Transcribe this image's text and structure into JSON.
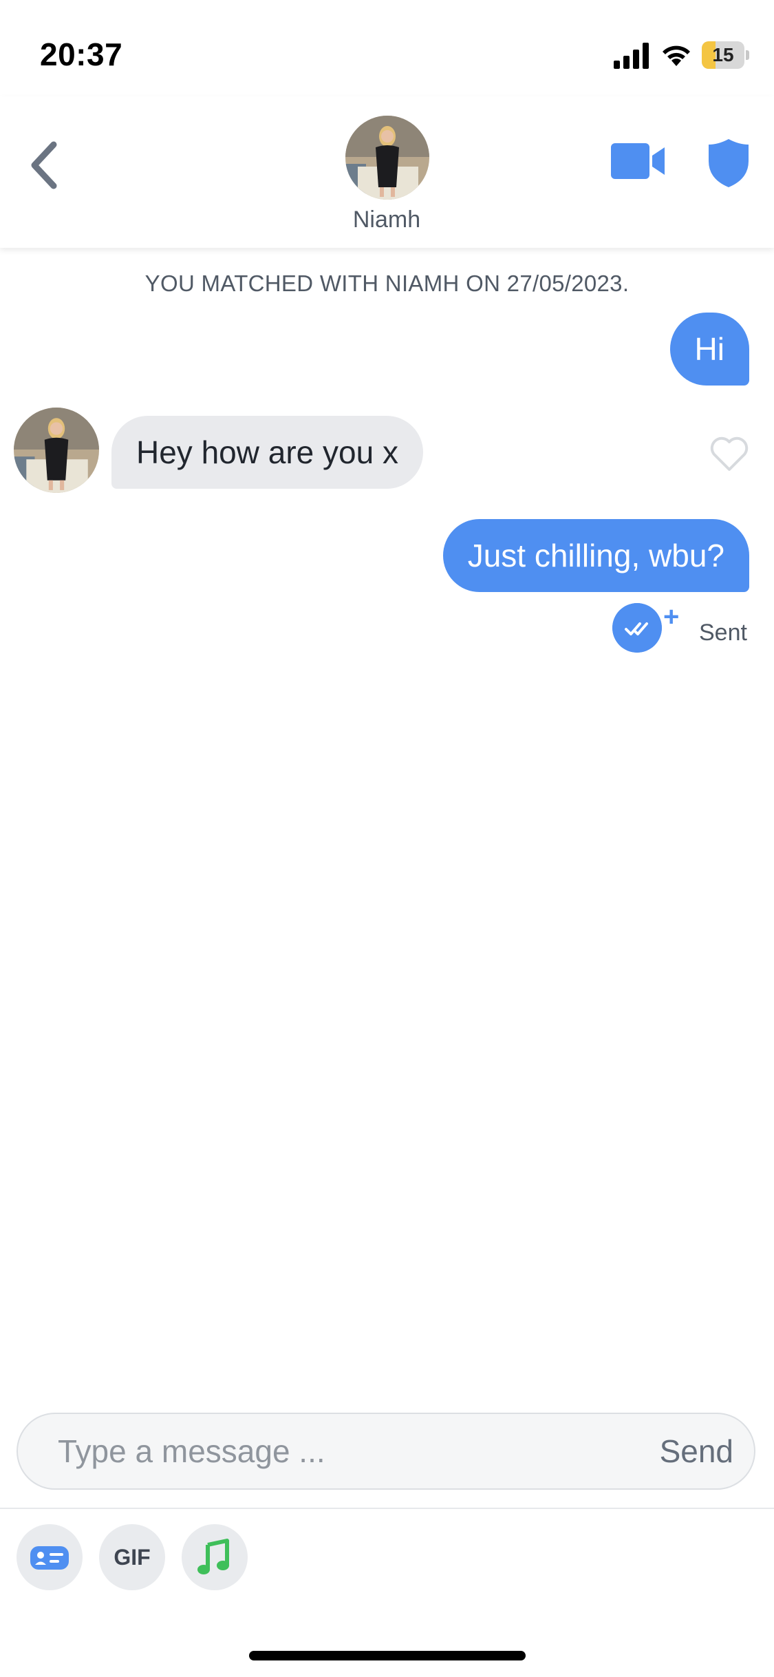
{
  "status_bar": {
    "time": "20:37",
    "battery_level": "15",
    "battery_fraction": 0.15,
    "icons": [
      "signal-icon",
      "wifi-icon",
      "battery-icon"
    ]
  },
  "header": {
    "contact_name": "Niamh",
    "icons": [
      "chevron-left-icon",
      "video-camera-icon",
      "shield-icon"
    ]
  },
  "conversation": {
    "match_notice": "YOU MATCHED WITH NIAMH ON 27/05/2023.",
    "messages": [
      {
        "direction": "outgoing",
        "text": "Hi"
      },
      {
        "direction": "incoming",
        "text": "Hey how are you x"
      },
      {
        "direction": "outgoing",
        "text": "Just chilling, wbu?"
      }
    ],
    "receipt_plus": "+",
    "status": "Sent"
  },
  "composer": {
    "placeholder": "Type a message ...",
    "value": "",
    "send_label": "Send"
  },
  "tools": {
    "gif_label": "GIF",
    "icons": [
      "id-card-icon",
      "gif-icon",
      "music-note-icon"
    ]
  },
  "colors": {
    "accent": "#4f8ff1",
    "incoming_bubble": "#e9eaed",
    "battery_low": "#f4c543",
    "music_green": "#3fbf5a"
  }
}
